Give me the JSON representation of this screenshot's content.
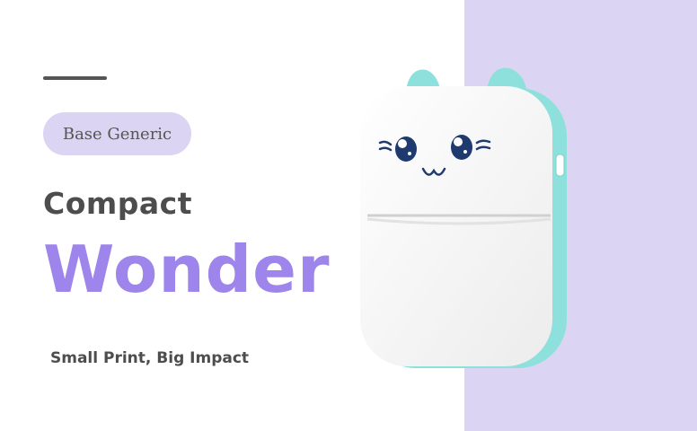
{
  "badge": {
    "label": "Base Generic"
  },
  "heading": {
    "line1": "Compact",
    "line2": "Wonder"
  },
  "tagline": "Small Print, Big Impact",
  "colors": {
    "accent_purple": "#9d85eb",
    "panel_lavender": "#dcd4f3",
    "text_dark": "#4d4d4d",
    "printer_mint": "#8de0dc",
    "printer_body": "#fbfbfb"
  },
  "product": {
    "icon": "cat-face-mini-printer-icon"
  }
}
